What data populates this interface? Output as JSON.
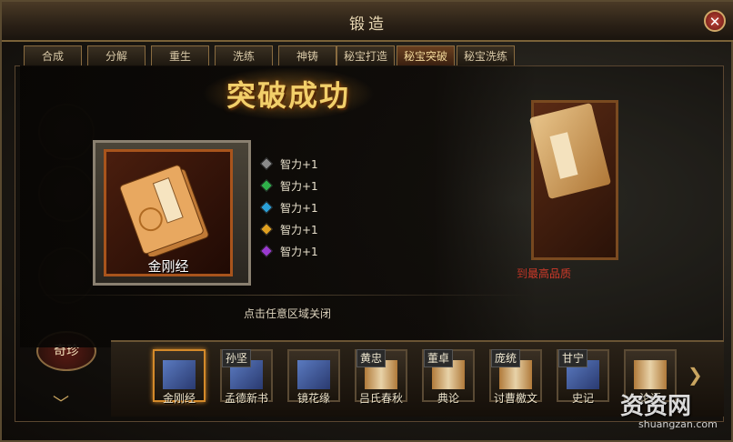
{
  "window": {
    "title": "锻造"
  },
  "tabs": [
    "合成",
    "分解",
    "重生",
    "洗练",
    "神铸",
    "秘宝打造",
    "秘宝突破",
    "秘宝洗练"
  ],
  "active_tab": "秘宝突破",
  "popup": {
    "banner": "突破成功",
    "item_name": "金刚经",
    "stats": [
      {
        "text": "智力+1",
        "color": "#8a8a8a"
      },
      {
        "text": "智力+1",
        "color": "#2fb04a"
      },
      {
        "text": "智力+1",
        "color": "#2aa0d8"
      },
      {
        "text": "智力+1",
        "color": "#e0a020"
      },
      {
        "text": "智力+1",
        "color": "#9a3ad0"
      }
    ],
    "close_hint": "点击任意区域关闭"
  },
  "background": {
    "red_hint": "到最高品质"
  },
  "sidebar": {
    "qizhen_label": "奇珍"
  },
  "items": [
    {
      "label": "金刚经",
      "tag": "",
      "selected": true,
      "icon": "book-icon"
    },
    {
      "label": "孟德新书",
      "tag": "孙坚",
      "selected": false,
      "icon": "book-icon"
    },
    {
      "label": "镜花缘",
      "tag": "",
      "selected": false,
      "icon": "book-icon"
    },
    {
      "label": "吕氏春秋",
      "tag": "黄忠",
      "selected": false,
      "icon": "scroll-icon"
    },
    {
      "label": "典论",
      "tag": "董卓",
      "selected": false,
      "icon": "scroll-icon"
    },
    {
      "label": "讨曹檄文",
      "tag": "庞统",
      "selected": false,
      "icon": "scroll-icon"
    },
    {
      "label": "史记",
      "tag": "甘宁",
      "selected": false,
      "icon": "book-icon"
    },
    {
      "label": "论语",
      "tag": "",
      "selected": false,
      "icon": "scroll-icon"
    }
  ],
  "watermark": {
    "main": "资资网",
    "sub": "shuangzan.com"
  }
}
